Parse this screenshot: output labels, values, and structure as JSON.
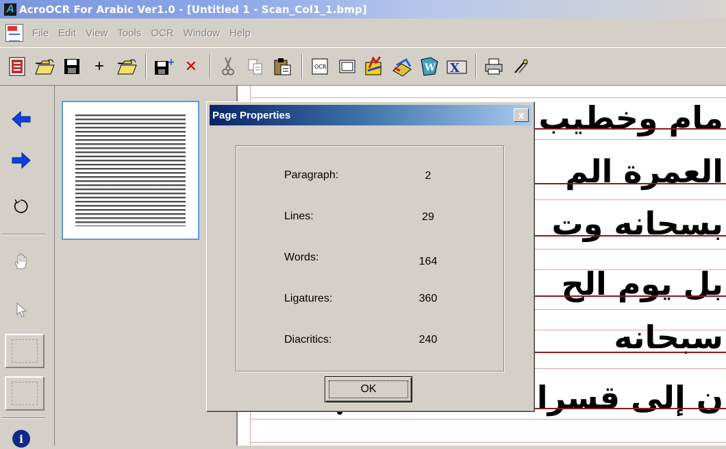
{
  "window": {
    "title": "AcroOCR For Arabic Ver1.0 - [Untitled 1 - Scan_Col1_1.bmp]",
    "app_icon_letter": "A"
  },
  "menu": {
    "items": [
      "File",
      "Edit",
      "View",
      "Tools",
      "OCR",
      "Window",
      "Help"
    ]
  },
  "toolbar": {
    "icons": [
      "properties-icon",
      "open-folder-icon",
      "save-icon",
      "add-icon",
      "open-folder-2-icon",
      "save-plus-icon",
      "delete-icon",
      "cut-icon",
      "copy-icon",
      "paste-icon",
      "ocr-icon",
      "scan-icon",
      "recognize-icon",
      "word-export-icon",
      "excel-export-icon",
      "print-icon",
      "settings-icon"
    ],
    "add_glyph": "+",
    "delete_glyph": "✕"
  },
  "document": {
    "arabic_lines": [
      "مام وخطيب",
      "العمرة الم",
      "بسحانه وت",
      "بل يوم الح",
      "سبحانه",
      "ن إلى قسرا"
    ]
  },
  "dialog": {
    "title": "Page Properties",
    "close_glyph": "x",
    "properties": [
      {
        "label": "Paragraph:",
        "value": "2"
      },
      {
        "label": "Lines:",
        "value": "29"
      },
      {
        "label": "Words:",
        "value": "164"
      },
      {
        "label": "Ligatures:",
        "value": "360"
      },
      {
        "label": "Diacritics:",
        "value": "240"
      }
    ],
    "ok_label": "OK"
  },
  "colors": {
    "title_gradient_start": "#0a246a",
    "title_gradient_end": "#a6caf0",
    "baseline_color": "#8b1a1a",
    "guide_line_color": "#e9a0a0",
    "thumbnail_border": "#5b9bd8"
  }
}
